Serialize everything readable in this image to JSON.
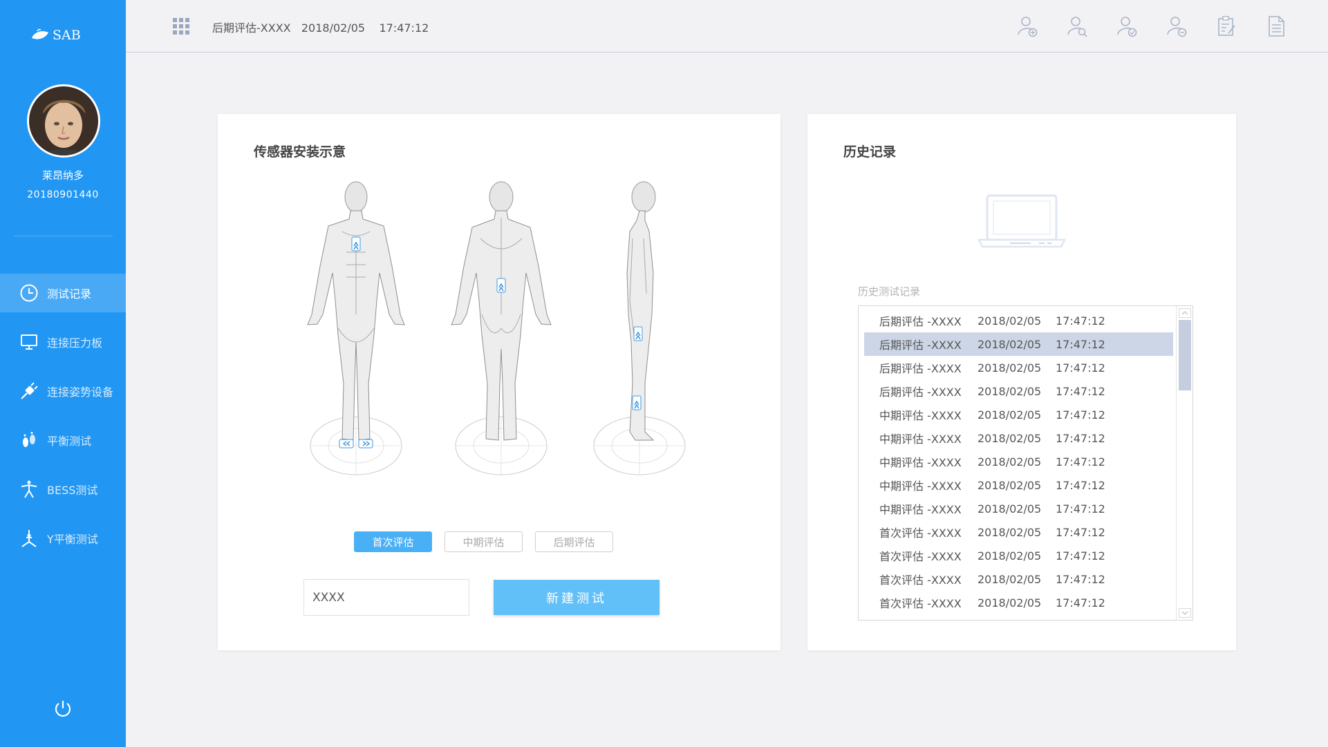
{
  "sidebar": {
    "logo_text": "SAB",
    "user_name": "莱昂纳多",
    "user_id": "20180901440",
    "nav": [
      {
        "label": "测试记录",
        "icon": "clock-icon",
        "active": true
      },
      {
        "label": "连接压力板",
        "icon": "monitor-icon",
        "active": false
      },
      {
        "label": "连接姿势设备",
        "icon": "plug-icon",
        "active": false
      },
      {
        "label": "平衡测试",
        "icon": "footprint-icon",
        "active": false
      },
      {
        "label": "BESS测试",
        "icon": "person-stance-icon",
        "active": false
      },
      {
        "label": "Y平衡测试",
        "icon": "y-balance-icon",
        "active": false
      }
    ],
    "power_icon": "power-icon",
    "bg_color": "#2196f3"
  },
  "topbar": {
    "title": "后期评估-XXXX   2018/02/05    17:47:12",
    "icons": [
      "add-user-icon",
      "search-user-icon",
      "verify-user-icon",
      "remove-user-icon",
      "clipboard-edit-icon",
      "document-icon"
    ]
  },
  "sensor_panel": {
    "title": "传感器安装示意",
    "tabs": [
      {
        "label": "首次评估",
        "active": true
      },
      {
        "label": "中期评估",
        "active": false
      },
      {
        "label": "后期评估",
        "active": false
      }
    ],
    "input_value": "XXXX",
    "new_test_label": "新建测试",
    "accent": "#4ab0f6"
  },
  "history_panel": {
    "title": "历史记录",
    "list_label": "历史测试记录",
    "selected_index": 1,
    "rows": [
      {
        "type": "后期评估 -XXXX",
        "date": "2018/02/05",
        "time": "17:47:12"
      },
      {
        "type": "后期评估 -XXXX",
        "date": "2018/02/05",
        "time": "17:47:12"
      },
      {
        "type": "后期评估 -XXXX",
        "date": "2018/02/05",
        "time": "17:47:12"
      },
      {
        "type": "后期评估 -XXXX",
        "date": "2018/02/05",
        "time": "17:47:12"
      },
      {
        "type": "中期评估 -XXXX",
        "date": "2018/02/05",
        "time": "17:47:12"
      },
      {
        "type": "中期评估 -XXXX",
        "date": "2018/02/05",
        "time": "17:47:12"
      },
      {
        "type": "中期评估 -XXXX",
        "date": "2018/02/05",
        "time": "17:47:12"
      },
      {
        "type": "中期评估 -XXXX",
        "date": "2018/02/05",
        "time": "17:47:12"
      },
      {
        "type": "中期评估 -XXXX",
        "date": "2018/02/05",
        "time": "17:47:12"
      },
      {
        "type": "首次评估 -XXXX",
        "date": "2018/02/05",
        "time": "17:47:12"
      },
      {
        "type": "首次评估 -XXXX",
        "date": "2018/02/05",
        "time": "17:47:12"
      },
      {
        "type": "首次评估 -XXXX",
        "date": "2018/02/05",
        "time": "17:47:12"
      },
      {
        "type": "首次评估 -XXXX",
        "date": "2018/02/05",
        "time": "17:47:12"
      }
    ]
  }
}
